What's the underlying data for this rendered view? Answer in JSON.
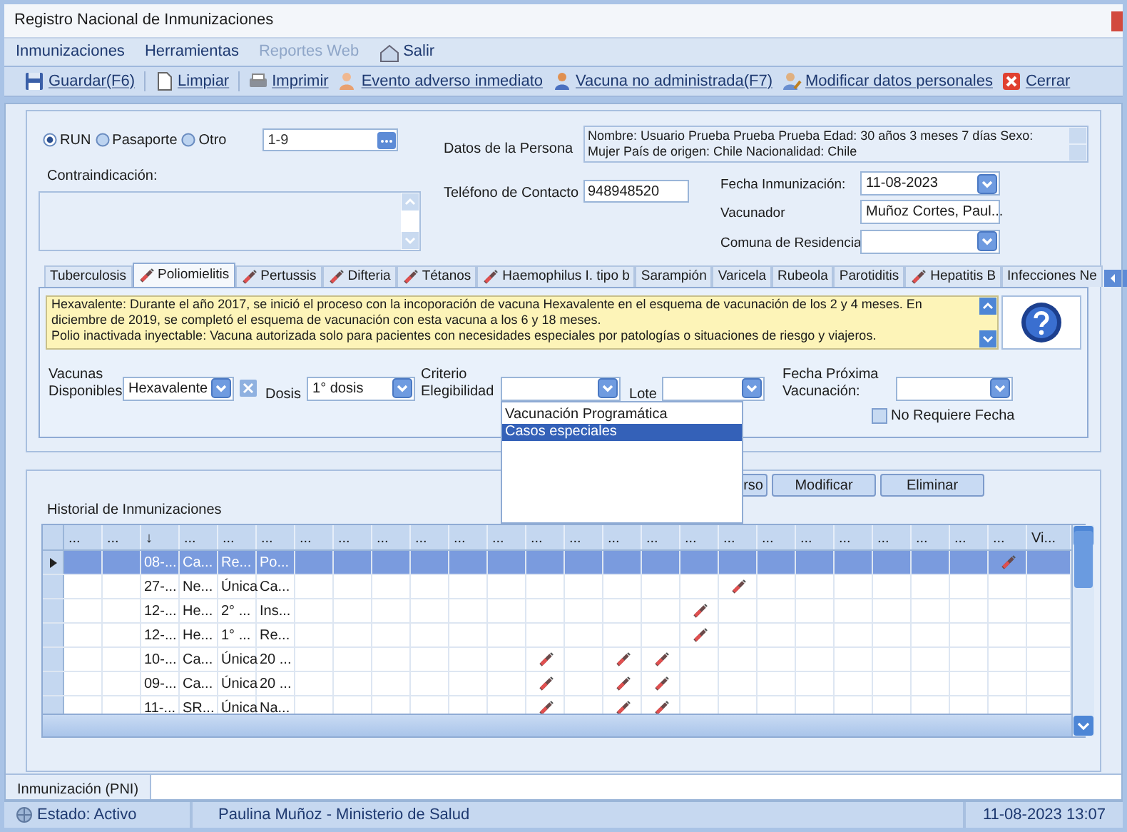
{
  "window": {
    "title": "Registro Nacional de Inmunizaciones"
  },
  "menu": [
    {
      "label": "Inmunizaciones",
      "disabled": false
    },
    {
      "label": "Herramientas",
      "disabled": false
    },
    {
      "label": "Reportes Web",
      "disabled": true
    },
    {
      "label": "Salir",
      "disabled": false
    }
  ],
  "toolbar": [
    "Guardar(F6)",
    "Limpiar",
    "Imprimir",
    "Evento adverso inmediato",
    "Vacuna no administrada(F7)",
    "Modificar datos personales",
    "Cerrar"
  ],
  "id_type": [
    {
      "label": "RUN",
      "selected": true
    },
    {
      "label": "Pasaporte",
      "selected": false
    },
    {
      "label": "Otro",
      "selected": false
    }
  ],
  "id_value": "1-9",
  "person": {
    "label": "Datos de la Persona",
    "value": "Nombre: Usuario Prueba Prueba Prueba  Edad: 30 años 3 meses 7 días  Sexo: Mujer País de origen: Chile Nacionalidad: Chile"
  },
  "contraindication": {
    "label": "Contraindicación:"
  },
  "phone": {
    "label": "Teléfono de Contacto",
    "value": "948948520"
  },
  "date": {
    "label": "Fecha Inmunización:",
    "value": "11-08-2023"
  },
  "vaccinator": {
    "label": "Vacunador",
    "value": "Muñoz Cortes, Paul..."
  },
  "commune": {
    "label": "Comuna de Residencia"
  },
  "tabs": [
    {
      "label": "Tuberculosis",
      "selected": false,
      "marked": false
    },
    {
      "label": "Poliomielitis",
      "selected": true,
      "marked": true
    },
    {
      "label": "Pertussis",
      "selected": false,
      "marked": true
    },
    {
      "label": "Difteria",
      "selected": false,
      "marked": true
    },
    {
      "label": "Tétanos",
      "selected": false,
      "marked": true
    },
    {
      "label": "Haemophilus I. tipo b",
      "selected": false,
      "marked": true
    },
    {
      "label": "Sarampión",
      "selected": false,
      "marked": false
    },
    {
      "label": "Varicela",
      "selected": false,
      "marked": false
    },
    {
      "label": "Rubeola",
      "selected": false,
      "marked": false
    },
    {
      "label": "Parotiditis",
      "selected": false,
      "marked": false
    },
    {
      "label": "Hepatitis B",
      "selected": false,
      "marked": true
    },
    {
      "label": "Infecciones Ne",
      "selected": false,
      "marked": false
    }
  ],
  "info_lines": [
    "Hexavalente: Durante el año 2017, se inició el proceso con la incoporación de vacuna Hexavalente en el esquema de vacunación de los 2 y 4 meses. En diciembre de 2019, se completó el esquema de vacunación con esta vacuna a los 6 y 18 meses.",
    "Polio inactivada inyectable: Vacuna autorizada solo para pacientes con necesidades especiales por patologías o situaciones de riesgo y viajeros."
  ],
  "vaccines": {
    "label": "Vacunas Disponibles",
    "value": "Hexavalente"
  },
  "dose": {
    "label": "Dosis",
    "value": "1° dosis"
  },
  "criteria": {
    "label": "Criterio Elegibilidad",
    "options": [
      {
        "label": "Vacunación Programática",
        "selected": false
      },
      {
        "label": "Casos especiales",
        "selected": true
      }
    ]
  },
  "lot": {
    "label": "Lote"
  },
  "next_date": {
    "label": "Fecha Próxima Vacunación:"
  },
  "no_date": {
    "label": "No Requiere Fecha",
    "checked": false
  },
  "buttons": [
    "rso",
    "Modificar",
    "Eliminar"
  ],
  "history": {
    "title": "Historial de Inmunizaciones",
    "columns": [
      "...",
      "...",
      "↓",
      "...",
      "...",
      "...",
      "...",
      "...",
      "...",
      "...",
      "...",
      "...",
      "...",
      "...",
      "...",
      "...",
      "...",
      "...",
      "...",
      "...",
      "...",
      "...",
      "...",
      "...",
      "...",
      "Vi..."
    ],
    "rows": [
      {
        "selected": true,
        "column_3": "08-...",
        "column_4": "Ca...",
        "column_5": "Re...",
        "column_6": "Po...",
        "syringes": [
          false,
          false,
          false,
          false,
          false,
          false,
          false,
          false,
          false,
          false,
          false,
          false,
          false,
          false,
          false,
          false,
          false,
          false,
          true,
          false
        ]
      },
      {
        "selected": false,
        "column_3": "27-...",
        "column_4": "Ne...",
        "column_5": "Única",
        "column_6": "Ca...",
        "syringes": [
          false,
          false,
          false,
          false,
          false,
          false,
          false,
          false,
          false,
          false,
          false,
          true,
          false,
          false,
          false,
          false,
          false,
          false,
          false,
          false
        ]
      },
      {
        "selected": false,
        "column_3": "12-...",
        "column_4": "He...",
        "column_5": "2° ...",
        "column_6": "Ins...",
        "syringes": [
          false,
          false,
          false,
          false,
          false,
          false,
          false,
          false,
          false,
          false,
          true,
          false,
          false,
          false,
          false,
          false,
          false,
          false,
          false,
          false
        ]
      },
      {
        "selected": false,
        "column_3": "12-...",
        "column_4": "He...",
        "column_5": "1° ...",
        "column_6": "Re...",
        "syringes": [
          false,
          false,
          false,
          false,
          false,
          false,
          false,
          false,
          false,
          false,
          true,
          false,
          false,
          false,
          false,
          false,
          false,
          false,
          false,
          false
        ]
      },
      {
        "selected": false,
        "column_3": "10-...",
        "column_4": "Ca...",
        "column_5": "Única",
        "column_6": "20 ...",
        "syringes": [
          false,
          false,
          false,
          false,
          false,
          false,
          true,
          false,
          true,
          true,
          false,
          false,
          false,
          false,
          false,
          false,
          false,
          false,
          false,
          false
        ]
      },
      {
        "selected": false,
        "column_3": "09-...",
        "column_4": "Ca...",
        "column_5": "Única",
        "column_6": "20 ...",
        "syringes": [
          false,
          false,
          false,
          false,
          false,
          false,
          true,
          false,
          true,
          true,
          false,
          false,
          false,
          false,
          false,
          false,
          false,
          false,
          false,
          false
        ]
      },
      {
        "selected": false,
        "column_3": "11-...",
        "column_4": "SR...",
        "column_5": "Única",
        "column_6": "Na...",
        "syringes": [
          false,
          false,
          false,
          false,
          false,
          false,
          true,
          false,
          true,
          true,
          false,
          false,
          false,
          false,
          false,
          false,
          false,
          false,
          false,
          false
        ]
      }
    ]
  },
  "bottom_tab": {
    "label": "Inmunización (PNI)"
  },
  "status_bar": {
    "state": "Estado: Activo",
    "user": "Paulina Muñoz - Ministerio de Salud",
    "datetime": "11-08-2023 13:07"
  }
}
